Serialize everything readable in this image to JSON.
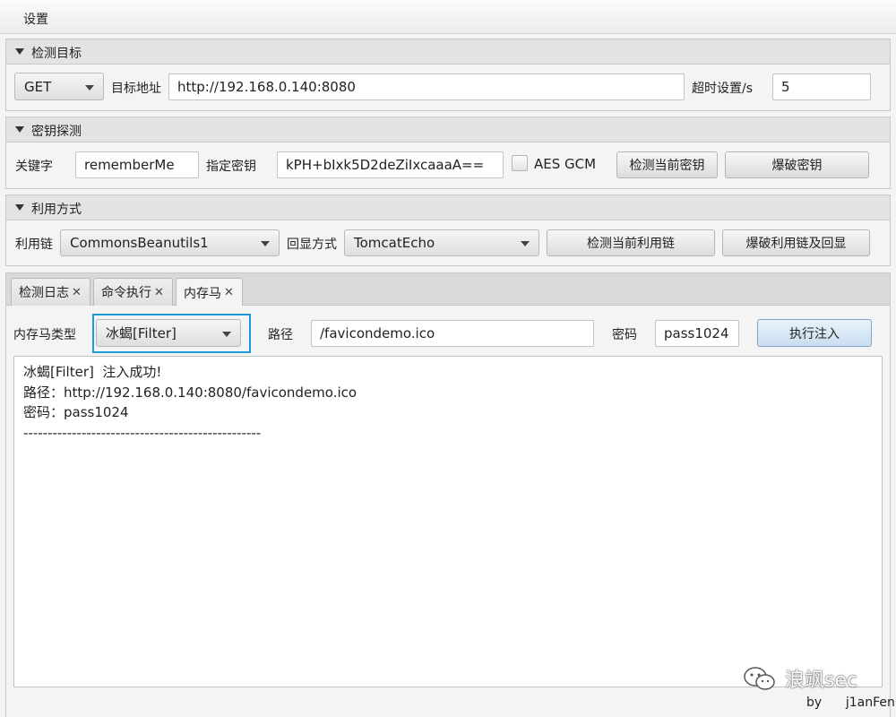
{
  "menubar": {
    "settings": "设置"
  },
  "detect_target": {
    "title": "检测目标",
    "method": "GET",
    "url_label": "目标地址",
    "url": "http://192.168.0.140:8080",
    "timeout_label": "超时设置/s",
    "timeout": "5"
  },
  "key_probe": {
    "title": "密钥探测",
    "keyword_label": "关键字",
    "keyword": "rememberMe",
    "key_label": "指定密钥",
    "key": "kPH+bIxk5D2deZiIxcaaaA==",
    "aes_gcm_label": "AES GCM",
    "aes_gcm_checked": false,
    "check_key_btn": "检测当前密钥",
    "brute_key_btn": "爆破密钥"
  },
  "exploit": {
    "title": "利用方式",
    "chain_label": "利用链",
    "chain": "CommonsBeanutils1",
    "echo_label": "回显方式",
    "echo": "TomcatEcho",
    "check_chain_btn": "检测当前利用链",
    "brute_chain_btn": "爆破利用链及回显"
  },
  "tabs": [
    {
      "label": "检测日志",
      "close": "✕"
    },
    {
      "label": "命令执行",
      "close": "✕"
    },
    {
      "label": "内存马",
      "close": "✕"
    }
  ],
  "memshell": {
    "type_label": "内存马类型",
    "type": "冰蝎[Filter]",
    "path_label": "路径",
    "path": "/favicondemo.ico",
    "password_label": "密码",
    "password": "pass1024",
    "inject_btn": "执行注入",
    "output_lines": [
      "冰蝎[Filter]  注入成功!",
      "路径：http://192.168.0.140:8080/favicondemo.ico",
      "密码：pass1024",
      "-------------------------------------------------"
    ]
  },
  "watermark": "浪飒sec",
  "footer": "by      j1anFen"
}
